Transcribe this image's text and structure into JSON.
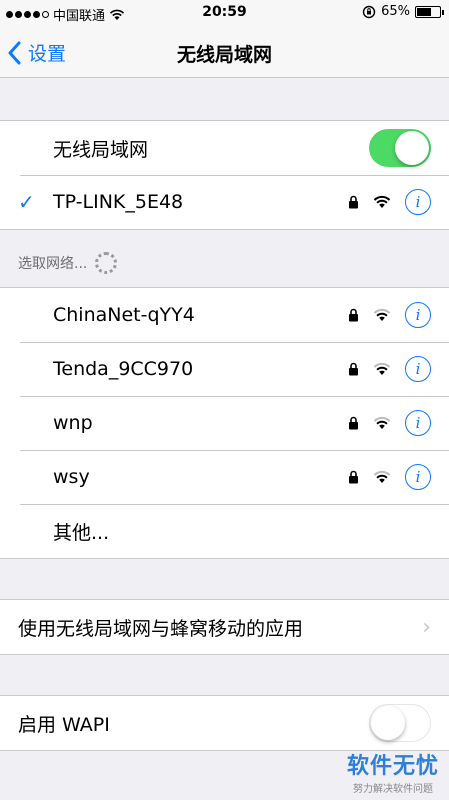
{
  "statusbar": {
    "carrier": "中国联通",
    "time": "20:59",
    "battery": "65%",
    "battery_level": 0.65
  },
  "navbar": {
    "back_label": "设置",
    "title": "无线局域网"
  },
  "wifi_toggle": {
    "label": "无线局域网",
    "on": true
  },
  "connected": {
    "name": "TP-LINK_5E48"
  },
  "section": {
    "header": "选取网络..."
  },
  "networks": [
    {
      "name": "ChinaNet-qYY4"
    },
    {
      "name": "Tenda_9CC970"
    },
    {
      "name": "wnp"
    },
    {
      "name": "wsy"
    }
  ],
  "other_label": "其他...",
  "apps_row": {
    "label": "使用无线局域网与蜂窝移动的应用"
  },
  "wapi": {
    "label": "启用 WAPI",
    "on": false
  },
  "watermark": {
    "title": "软件无忧",
    "subtitle": "努力解决软件问题"
  },
  "colors": {
    "accent": "#0a7aff",
    "toggle_on": "#4cd964",
    "background": "#efeff4"
  },
  "icons": {
    "lock": "lock-icon",
    "wifi": "wifi-icon",
    "info": "info-icon",
    "check": "checkmark-icon"
  }
}
